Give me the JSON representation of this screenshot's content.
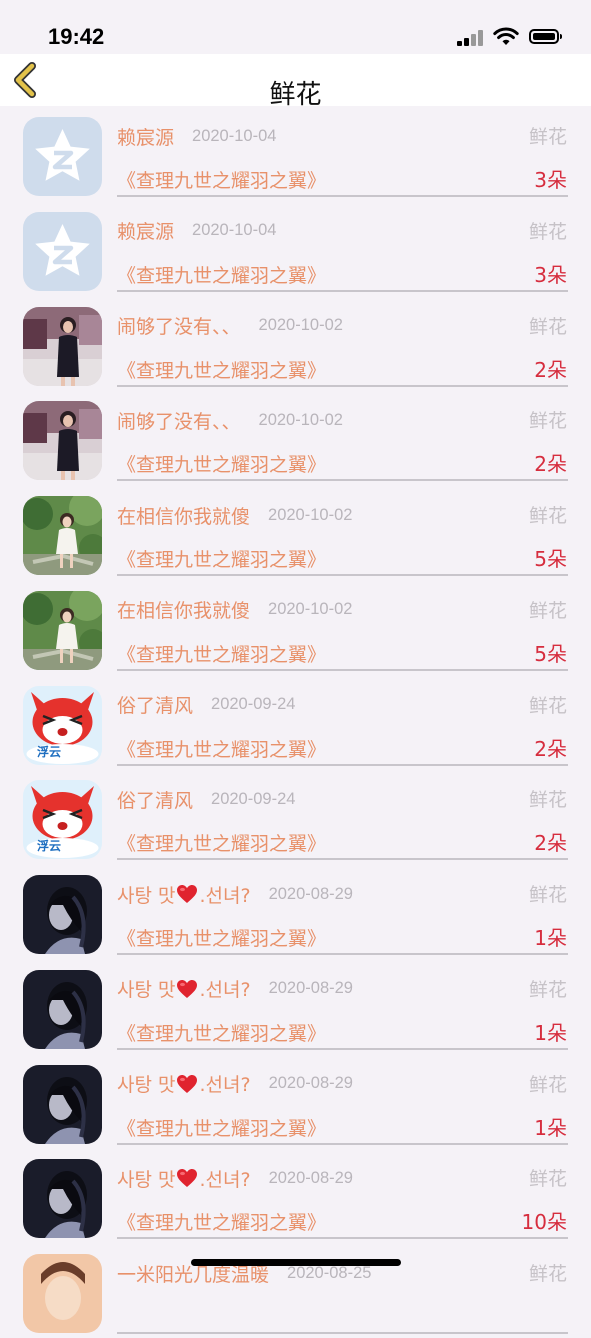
{
  "status_bar": {
    "time": "19:42"
  },
  "nav": {
    "title": "鲜花"
  },
  "rows": [
    {
      "name": "赖宸源",
      "date": "2020-10-04",
      "gift": "鲜花",
      "product": "《查理九世之耀羽之翼》",
      "count": "3朵",
      "avatar": "qq-star"
    },
    {
      "name": "赖宸源",
      "date": "2020-10-04",
      "gift": "鲜花",
      "product": "《查理九世之耀羽之翼》",
      "count": "3朵",
      "avatar": "qq-star"
    },
    {
      "name": "闹够了没有、、",
      "date": "2020-10-02",
      "gift": "鲜花",
      "product": "《查理九世之耀羽之翼》",
      "count": "2朵",
      "avatar": "photo-woman-shop"
    },
    {
      "name": "闹够了没有、、",
      "date": "2020-10-02",
      "gift": "鲜花",
      "product": "《查理九世之耀羽之翼》",
      "count": "2朵",
      "avatar": "photo-woman-shop"
    },
    {
      "name": "在相信你我就傻",
      "date": "2020-10-02",
      "gift": "鲜花",
      "product": "《查理九世之耀羽之翼》",
      "count": "5朵",
      "avatar": "photo-girl-garden"
    },
    {
      "name": "在相信你我就傻",
      "date": "2020-10-02",
      "gift": "鲜花",
      "product": "《查理九世之耀羽之翼》",
      "count": "5朵",
      "avatar": "photo-girl-garden"
    },
    {
      "name": "俗了清风",
      "date": "2020-09-24",
      "gift": "鲜花",
      "product": "《查理九世之耀羽之翼》",
      "count": "2朵",
      "avatar": "cartoon-fox"
    },
    {
      "name": "俗了清风",
      "date": "2020-09-24",
      "gift": "鲜花",
      "product": "《查理九世之耀羽之翼》",
      "count": "2朵",
      "avatar": "cartoon-fox"
    },
    {
      "name": "사탕 맛",
      "name_suffix": ".선녀?",
      "date": "2020-08-29",
      "gift": "鲜花",
      "product": "《查理九世之耀羽之翼》",
      "count": "1朵",
      "avatar": "photo-dark-girl"
    },
    {
      "name": "사탕 맛",
      "name_suffix": ".선녀?",
      "date": "2020-08-29",
      "gift": "鲜花",
      "product": "《查理九世之耀羽之翼》",
      "count": "1朵",
      "avatar": "photo-dark-girl"
    },
    {
      "name": "사탕 맛",
      "name_suffix": ".선녀?",
      "date": "2020-08-29",
      "gift": "鲜花",
      "product": "《查理九世之耀羽之翼》",
      "count": "1朵",
      "avatar": "photo-dark-girl"
    },
    {
      "name": "사탕 맛",
      "name_suffix": ".선녀?",
      "date": "2020-08-29",
      "gift": "鲜花",
      "product": "《查理九世之耀羽之翼》",
      "count": "10朵",
      "avatar": "photo-dark-girl"
    },
    {
      "name": "一米阳光几度温暖",
      "date": "2020-08-25",
      "gift": "鲜花",
      "product": "",
      "count": "",
      "avatar": "photo-warm"
    }
  ],
  "colors": {
    "name": "#e8916a",
    "date": "#b9b5bb",
    "count": "#d62d3e",
    "back_arrow": "#e2c24a"
  }
}
